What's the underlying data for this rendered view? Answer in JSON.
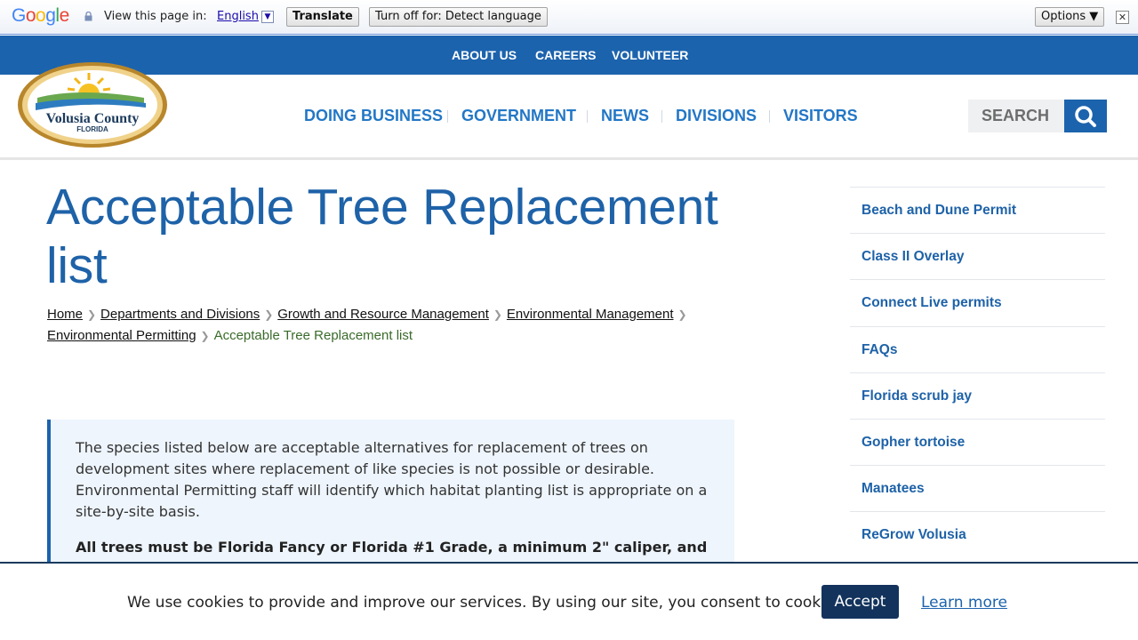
{
  "translate_bar": {
    "logo_text": "Google",
    "label": "View this page in:",
    "language": "English",
    "translate_button": "Translate",
    "turn_off_button": "Turn off for: Detect language",
    "options_button": "Options ▼",
    "close_glyph": "✕"
  },
  "utility_nav": [
    "ABOUT US",
    "CAREERS",
    "VOLUNTEER"
  ],
  "logo": {
    "name": "Volusia County",
    "state": "FLORIDA"
  },
  "main_nav": [
    "DOING BUSINESS",
    "GOVERNMENT",
    "NEWS",
    "DIVISIONS",
    "VISITORS"
  ],
  "search": {
    "label": "SEARCH"
  },
  "page_title": "Acceptable Tree Replacement list",
  "breadcrumbs": {
    "links": [
      "Home",
      "Departments and Divisions",
      "Growth and Resource Management",
      "Environmental Management",
      "Environmental Permitting"
    ],
    "current": "Acceptable Tree Replacement list"
  },
  "callout": {
    "paragraph": "The species listed below are acceptable alternatives for replacement of trees on development sites where replacement of like species is not possible or desirable. Environmental Permitting staff will identify which habitat planting list is appropriate on a site-by-site basis.",
    "bold": "All trees must be Florida Fancy or Florida #1 Grade, a minimum 2\" caliper, and"
  },
  "sidebar": [
    "Beach and Dune Permit",
    "Class II Overlay",
    "Connect Live permits",
    "FAQs",
    "Florida scrub jay",
    "Gopher tortoise",
    "Manatees",
    "ReGrow Volusia"
  ],
  "cookie": {
    "message": "We use cookies to provide and improve our services. By using our site, you consent to cookies.",
    "accept": "Accept",
    "learn_more": "Learn more"
  },
  "colors": {
    "brand_blue": "#1c63ad",
    "nav_text": "#2377c6",
    "cookie_button": "#13335c",
    "breadcrumb_current": "#3a6b2a"
  }
}
